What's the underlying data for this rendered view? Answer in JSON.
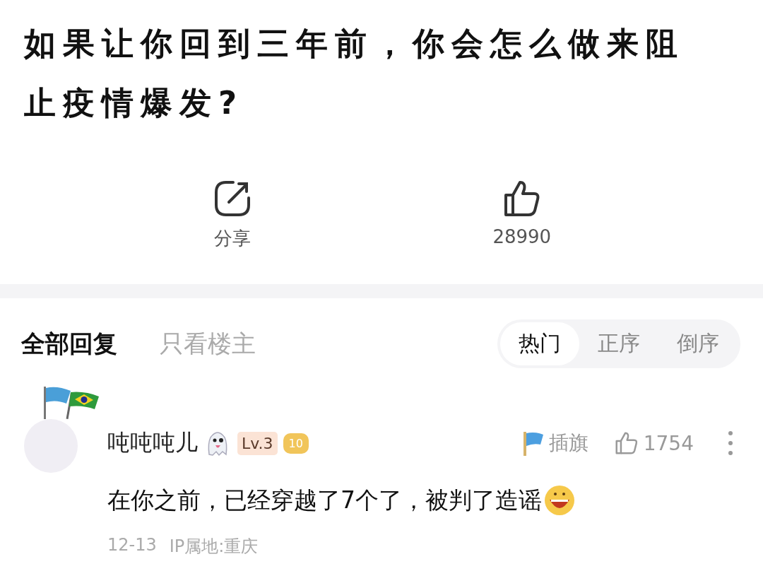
{
  "question": {
    "title": "如果让你回到三年前，你会怎么做来阻止疫情爆发?"
  },
  "actions": [
    {
      "kind": "share",
      "label": "分享"
    },
    {
      "kind": "like",
      "label": "28990"
    }
  ],
  "filters": [
    {
      "label": "全部回复",
      "selected": true
    },
    {
      "label": "只看楼主",
      "selected": false
    }
  ],
  "sort_tabs": [
    {
      "label": "热门",
      "selected": true
    },
    {
      "label": "正序",
      "selected": false
    },
    {
      "label": "倒序",
      "selected": false
    }
  ],
  "replies": [
    {
      "user": "吨吨吨儿",
      "level": "Lv.3",
      "badge": "10",
      "flag_label": "插旗",
      "likes": "1754",
      "text": "在你之前，已经穿越了7个了，被判了造谣",
      "date": "12-13",
      "ip": "IP属地:重庆"
    }
  ]
}
